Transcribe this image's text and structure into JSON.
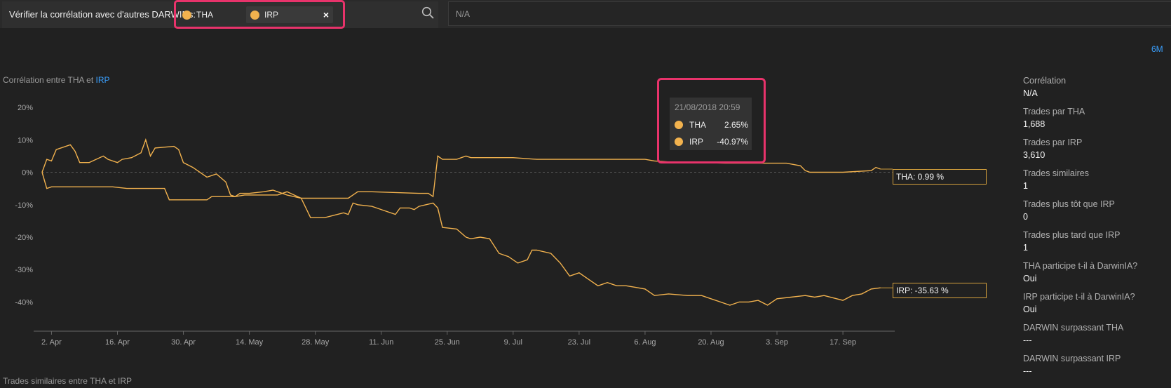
{
  "header": {
    "search_label": "Vérifier la corrélation avec d'autres DARWINs:",
    "chips": [
      {
        "label": "THA",
        "removable": false
      },
      {
        "label": "IRP",
        "removable": true
      }
    ],
    "chip_close": "×",
    "na_value": "N/A"
  },
  "range_label": "6M",
  "chart_title_prefix": "Corrélation entre THA et",
  "chart_title_link": "IRP",
  "bottom_title": "Trades similaires entre THA et IRP",
  "tooltip": {
    "date": "21/08/2018 20:59",
    "rows": [
      {
        "name": "THA",
        "value": "2.65%"
      },
      {
        "name": "IRP",
        "value": "-40.97%"
      }
    ]
  },
  "end_labels": {
    "tha": "THA: 0.99 %",
    "irp": "IRP: -35.63 %"
  },
  "colors": {
    "series": "#f2b24e",
    "accent": "#3aa0ff",
    "highlight": "#e8336b",
    "background": "#212121"
  },
  "stats": [
    {
      "label": "Corrélation",
      "value": "N/A"
    },
    {
      "label": "Trades par THA",
      "value": "1,688"
    },
    {
      "label": "Trades par IRP",
      "value": "3,610"
    },
    {
      "label": "Trades similaires",
      "value": "1"
    },
    {
      "label": "Trades plus tôt que IRP",
      "value": "0"
    },
    {
      "label": "Trades plus tard que IRP",
      "value": "1"
    },
    {
      "label": "THA participe t-il à DarwinIA?",
      "value": "Oui"
    },
    {
      "label": "IRP participe t-il à DarwinIA?",
      "value": "Oui"
    },
    {
      "label": "DARWIN surpassant THA",
      "value": "---"
    },
    {
      "label": "DARWIN surpassant IRP",
      "value": "---"
    }
  ],
  "chart_data": {
    "type": "line",
    "y_tick_labels": [
      "20%",
      "10%",
      "0%",
      "-10%",
      "-20%",
      "-30%",
      "-40%"
    ],
    "y_ticks": [
      20,
      10,
      0,
      -10,
      -20,
      -30,
      -40
    ],
    "ylim": [
      -49,
      25
    ],
    "x_tick_labels": [
      "2. Apr",
      "16. Apr",
      "30. Apr",
      "14. May",
      "28. May",
      "11. Jun",
      "25. Jun",
      "9. Jul",
      "23. Jul",
      "6. Aug",
      "20. Aug",
      "3. Sep",
      "17. Sep"
    ],
    "xlim_days": [
      0,
      181
    ],
    "grid": false,
    "series": [
      {
        "name": "THA",
        "points": [
          [
            0,
            0
          ],
          [
            1,
            4
          ],
          [
            2,
            3.5
          ],
          [
            3,
            7
          ],
          [
            6,
            8.5
          ],
          [
            7,
            6.5
          ],
          [
            8,
            3
          ],
          [
            10,
            3
          ],
          [
            13,
            5
          ],
          [
            14,
            4
          ],
          [
            16,
            3
          ],
          [
            17,
            4
          ],
          [
            19,
            4.5
          ],
          [
            21,
            6
          ],
          [
            22,
            10
          ],
          [
            23,
            5
          ],
          [
            24,
            7.5
          ],
          [
            28,
            8
          ],
          [
            29,
            7
          ],
          [
            30,
            3
          ],
          [
            32,
            1.5
          ],
          [
            35,
            -1.5
          ],
          [
            37,
            -0.5
          ],
          [
            39,
            -3
          ],
          [
            40,
            -7
          ],
          [
            41,
            -7.5
          ],
          [
            42,
            -6.5
          ],
          [
            44,
            -6.5
          ],
          [
            47,
            -6
          ],
          [
            49,
            -5.5
          ],
          [
            52,
            -7
          ],
          [
            55,
            -8
          ],
          [
            60,
            -8
          ],
          [
            65,
            -8
          ],
          [
            67,
            -6
          ],
          [
            70,
            -6
          ],
          [
            80,
            -6.5
          ],
          [
            82,
            -6.5
          ],
          [
            83,
            -7.5
          ],
          [
            84,
            5
          ],
          [
            85,
            4
          ],
          [
            88,
            4
          ],
          [
            89,
            4.5
          ],
          [
            90,
            5
          ],
          [
            91,
            4.5
          ],
          [
            100,
            4.5
          ],
          [
            105,
            4
          ],
          [
            110,
            4
          ],
          [
            115,
            4
          ],
          [
            120,
            4
          ],
          [
            128,
            4
          ],
          [
            130,
            3.5
          ],
          [
            135,
            3
          ],
          [
            140,
            3
          ],
          [
            145,
            2.8
          ],
          [
            158,
            2.8
          ],
          [
            161,
            2
          ],
          [
            162,
            0.5
          ],
          [
            163,
            0
          ],
          [
            170,
            0
          ],
          [
            176,
            0.5
          ],
          [
            177,
            1.5
          ],
          [
            178,
            0.99
          ]
        ]
      },
      {
        "name": "IRP",
        "points": [
          [
            0,
            0
          ],
          [
            1,
            -5
          ],
          [
            2,
            -4.5
          ],
          [
            15,
            -4.5
          ],
          [
            18,
            -5
          ],
          [
            26,
            -5
          ],
          [
            27,
            -8.5
          ],
          [
            35,
            -8.5
          ],
          [
            36,
            -7.5
          ],
          [
            41,
            -7.5
          ],
          [
            43,
            -7
          ],
          [
            50,
            -7
          ],
          [
            52,
            -6
          ],
          [
            55,
            -8
          ],
          [
            57,
            -14
          ],
          [
            60,
            -14
          ],
          [
            64,
            -12.5
          ],
          [
            65,
            -13
          ],
          [
            66,
            -9.5
          ],
          [
            67,
            -10
          ],
          [
            70,
            -10.5
          ],
          [
            71,
            -11
          ],
          [
            73,
            -12
          ],
          [
            75,
            -13
          ],
          [
            76,
            -11
          ],
          [
            78,
            -11
          ],
          [
            79,
            -11.5
          ],
          [
            80,
            -10.5
          ],
          [
            83,
            -9.5
          ],
          [
            84,
            -11
          ],
          [
            85,
            -17
          ],
          [
            88,
            -17.5
          ],
          [
            90,
            -20
          ],
          [
            91,
            -20.5
          ],
          [
            93,
            -20
          ],
          [
            95,
            -20.5
          ],
          [
            97,
            -25
          ],
          [
            99,
            -26
          ],
          [
            101,
            -28
          ],
          [
            103,
            -27
          ],
          [
            104,
            -24
          ],
          [
            105,
            -24
          ],
          [
            108,
            -25
          ],
          [
            110,
            -28
          ],
          [
            112,
            -32
          ],
          [
            114,
            -31
          ],
          [
            116,
            -33
          ],
          [
            118,
            -35
          ],
          [
            120,
            -34
          ],
          [
            122,
            -35
          ],
          [
            124,
            -35
          ],
          [
            126,
            -35.5
          ],
          [
            128,
            -36
          ],
          [
            130,
            -38
          ],
          [
            133,
            -37.5
          ],
          [
            137,
            -38
          ],
          [
            140,
            -38
          ],
          [
            144,
            -40
          ],
          [
            146,
            -41
          ],
          [
            148,
            -40
          ],
          [
            150,
            -40
          ],
          [
            152,
            -39.5
          ],
          [
            154,
            -40.97
          ],
          [
            156,
            -39
          ],
          [
            159,
            -38.5
          ],
          [
            162,
            -38
          ],
          [
            164,
            -38.5
          ],
          [
            166,
            -38
          ],
          [
            170,
            -39.5
          ],
          [
            172,
            -38
          ],
          [
            174,
            -37.5
          ],
          [
            176,
            -36
          ],
          [
            178,
            -35.63
          ]
        ]
      }
    ]
  }
}
